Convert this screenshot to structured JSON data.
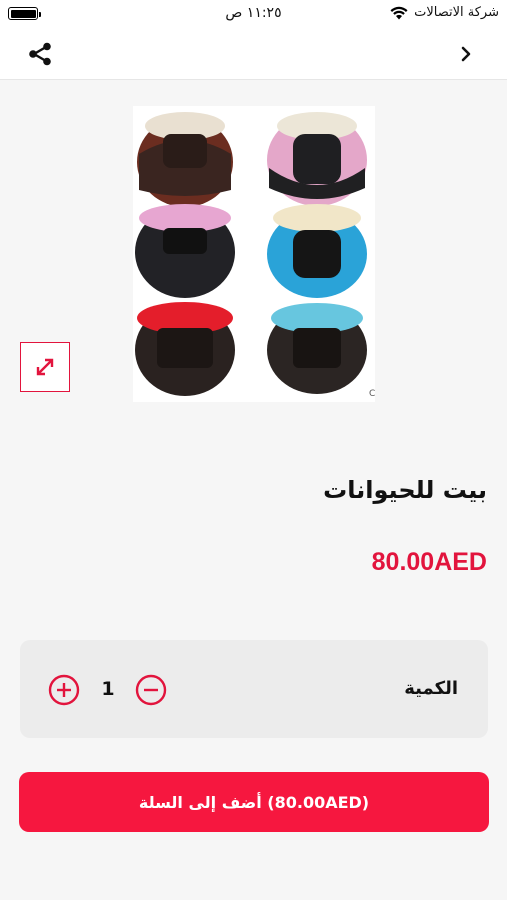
{
  "status_bar": {
    "time": "١١:٢٥ ص",
    "carrier": "شركة الاتصالات"
  },
  "nav": {
    "share_icon": "share-icon",
    "back_icon": "chevron-right-icon"
  },
  "product": {
    "image_text": "C",
    "title": "بيت للحيوانات",
    "price": "80.00AED"
  },
  "quantity": {
    "label": "الكمية",
    "value": "1"
  },
  "cart_button": {
    "label": "أضف إلى السلة (80.00AED)"
  },
  "colors": {
    "accent": "#e2143d",
    "button": "#f6173f"
  }
}
